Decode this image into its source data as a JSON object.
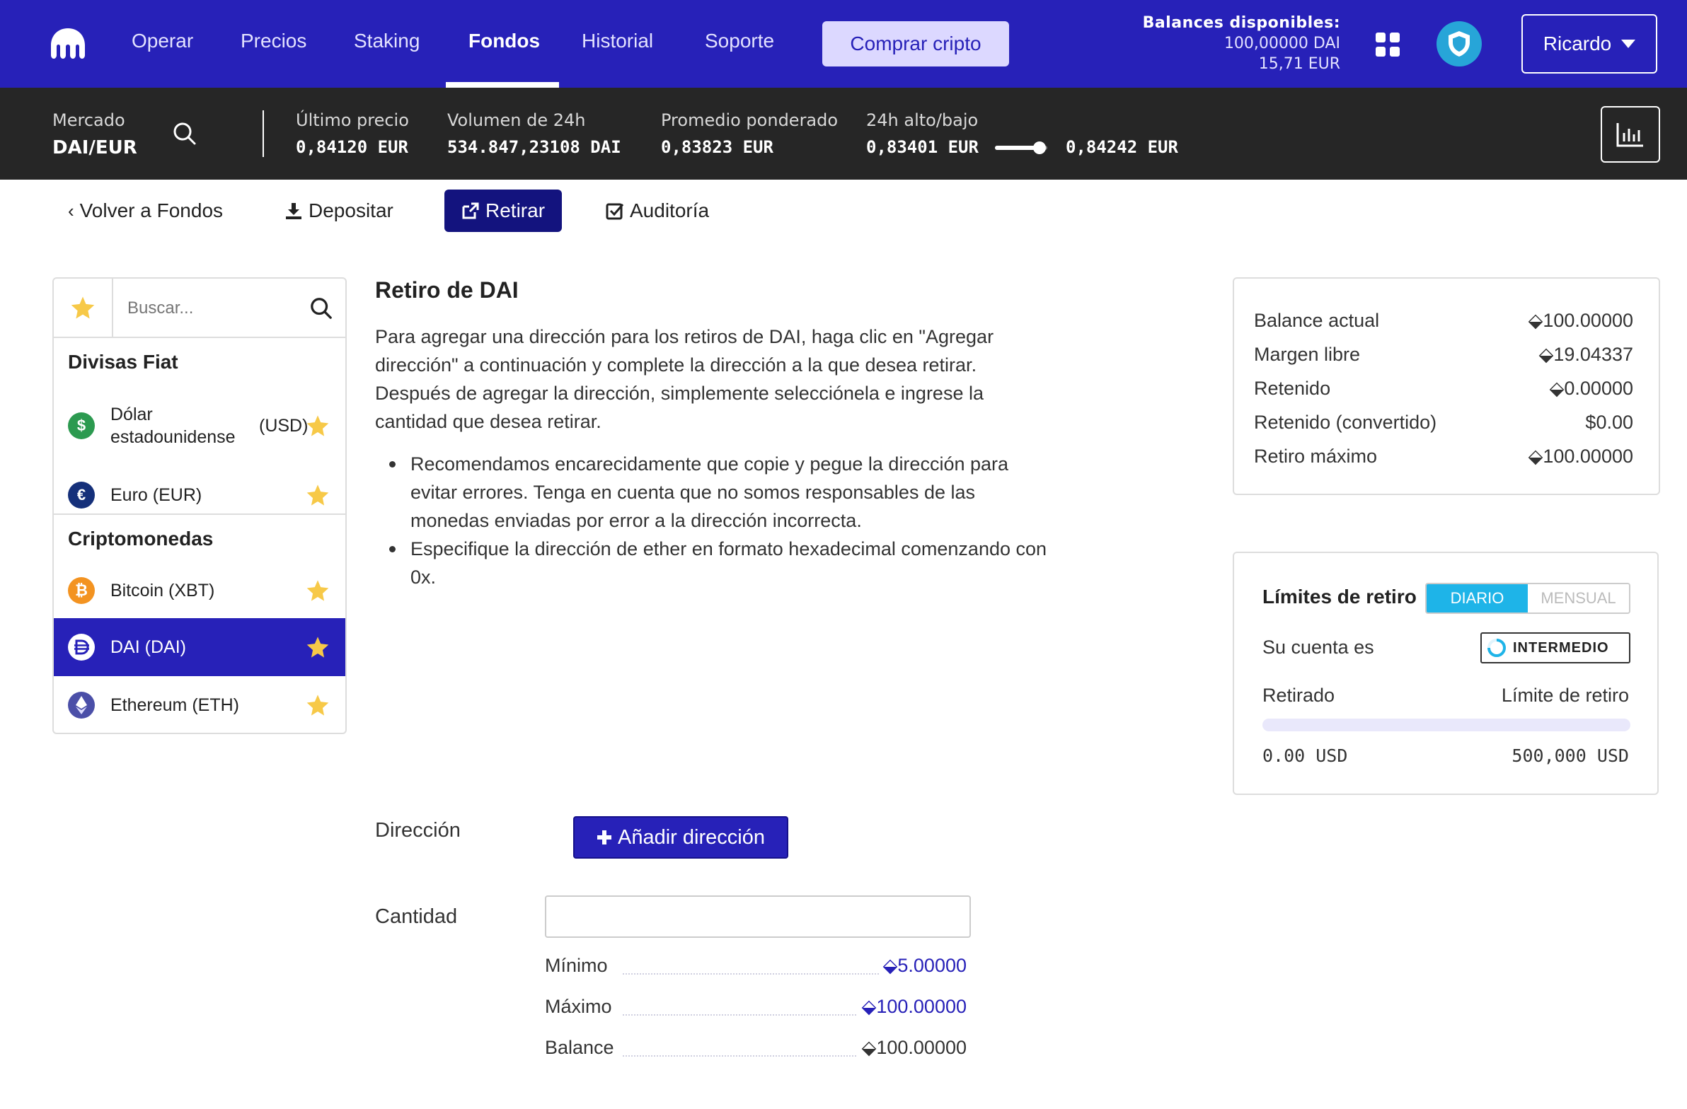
{
  "nav": {
    "items": [
      "Operar",
      "Precios",
      "Staking",
      "Fondos",
      "Historial",
      "Soporte"
    ],
    "active": "Fondos",
    "buy_label": "Comprar cripto",
    "balances_title": "Balances disponibles:",
    "balance_dai": "100,00000 DAI",
    "balance_eur": "15,71 EUR",
    "user": "Ricardo"
  },
  "ticker": {
    "market_label": "Mercado",
    "market_value": "DAI/EUR",
    "last_label": "Último precio",
    "last_value": "0,84120 EUR",
    "volume_label": "Volumen de 24h",
    "volume_value": "534.847,23108 DAI",
    "vwap_label": "Promedio ponderado",
    "vwap_value": "0,83823 EUR",
    "range_label": "24h alto/bajo",
    "low_value": "0,83401 EUR",
    "high_value": "0,84242 EUR",
    "range_position": 0.85
  },
  "subnav": {
    "back": "Volver a Fondos",
    "deposit": "Depositar",
    "withdraw": "Retirar",
    "audit": "Auditoría"
  },
  "assets": {
    "search_placeholder": "Buscar...",
    "fiat_heading": "Divisas Fiat",
    "crypto_heading": "Criptomonedas",
    "fiat": [
      {
        "name": "Dólar estadounidense",
        "code": "(USD)",
        "color": "#2c9a50",
        "icon": "dollar-sign-icon"
      },
      {
        "name": "Euro",
        "code": "(EUR)",
        "color": "#15307a",
        "icon": "euro-sign-icon"
      }
    ],
    "crypto": [
      {
        "name": "Bitcoin",
        "code": "(XBT)",
        "color": "#f39321",
        "icon": "bitcoin-icon"
      },
      {
        "name": "DAI",
        "code": "(DAI)",
        "color": "#2721b8",
        "icon": "dai-icon"
      },
      {
        "name": "Ethereum",
        "code": "(ETH)",
        "color": "#4b4fa8",
        "icon": "ethereum-icon"
      }
    ],
    "selected": "DAI",
    "star_color": "#f7c948"
  },
  "main": {
    "title": "Retiro de DAI",
    "paragraph": "Para agregar una dirección para los retiros de DAI, haga clic en \"Agregar dirección\" a continuación y complete la dirección a la que desea retirar. Después de agregar la dirección, simplemente selecciónela e ingrese la cantidad que desea retirar.",
    "bullets": [
      "Recomendamos encarecidamente que copie y pegue la dirección para evitar errores. Tenga en cuenta que no somos responsables de las monedas enviadas por error a la dirección incorrecta.",
      "Especifique la dirección de ether en formato hexadecimal comenzando con 0x."
    ],
    "address_label": "Dirección",
    "add_address": "Añadir dirección",
    "quantity_label": "Cantidad",
    "quantity_value": "",
    "min_label": "Mínimo",
    "min_value": "⬙5.00000",
    "max_label": "Máximo",
    "max_value": "⬙100.00000",
    "balance_label": "Balance",
    "balance_value": "⬙100.00000"
  },
  "balance_card": {
    "rows": [
      {
        "label": "Balance actual",
        "value": "⬙100.00000"
      },
      {
        "label": "Margen libre",
        "value": "⬙19.04337"
      },
      {
        "label": "Retenido",
        "value": "⬙0.00000"
      },
      {
        "label": "Retenido (convertido)",
        "value": "$0.00"
      },
      {
        "label": "Retiro máximo",
        "value": "⬙100.00000"
      }
    ]
  },
  "limits": {
    "title": "Límites de retiro",
    "daily": "DIARIO",
    "monthly": "MENSUAL",
    "account_label": "Su cuenta es",
    "tier": "INTERMEDIO",
    "withdrawn_label": "Retirado",
    "limit_label": "Límite de retiro",
    "withdrawn_value": "0.00 USD",
    "limit_value": "500,000 USD",
    "used_fraction": 0
  },
  "colors": {
    "brand": "#2721b8",
    "ticker_bg": "#262626",
    "accent": "#1eb4e8"
  }
}
